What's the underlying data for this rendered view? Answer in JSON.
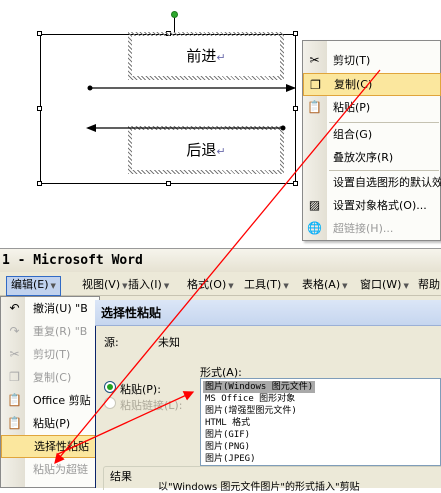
{
  "diagram": {
    "shape_forward_text": "前进",
    "shape_back_text": "后退",
    "paragraph_mark": "↵"
  },
  "context_menu": {
    "items": [
      {
        "label": "剪切(T)",
        "icon": "scissors-icon",
        "state": "normal"
      },
      {
        "label": "复制(C)",
        "icon": "copy-icon",
        "state": "highlighted"
      },
      {
        "label": "粘贴(P)",
        "icon": "paste-icon",
        "state": "normal"
      },
      {
        "label": "组合(G)",
        "icon": "",
        "state": "normal",
        "submenu": true
      },
      {
        "label": "叠放次序(R)",
        "icon": "",
        "state": "normal",
        "submenu": true
      },
      {
        "label": "设置自选图形的默认效果",
        "icon": "",
        "state": "normal"
      },
      {
        "label": "设置对象格式(O)...",
        "icon": "format-object-icon",
        "state": "normal"
      },
      {
        "label": "超链接(H)...",
        "icon": "hyperlink-icon",
        "state": "disabled"
      }
    ]
  },
  "window": {
    "title": "1 - Microsoft Word"
  },
  "menubar": {
    "items": [
      {
        "label": "编辑(E)",
        "open": true
      },
      {
        "label": "视图(V)"
      },
      {
        "label": "插入(I)"
      },
      {
        "label": "格式(O)"
      },
      {
        "label": "工具(T)"
      },
      {
        "label": "表格(A)"
      },
      {
        "label": "窗口(W)"
      },
      {
        "label": "帮助"
      }
    ]
  },
  "edit_menu": {
    "items": [
      {
        "label": "撤消(U) \"B",
        "icon": "undo-icon",
        "state": "normal"
      },
      {
        "label": "重复(R) \"B",
        "icon": "redo-icon",
        "state": "disabled"
      },
      {
        "label": "剪切(T)",
        "icon": "scissors-icon",
        "state": "disabled"
      },
      {
        "label": "复制(C)",
        "icon": "copy-icon",
        "state": "disabled"
      },
      {
        "label": "Office 剪贴",
        "icon": "clipboard-icon",
        "state": "normal"
      },
      {
        "label": "粘贴(P)",
        "icon": "paste-icon",
        "state": "normal"
      },
      {
        "label": "选择性粘贴",
        "icon": "",
        "state": "highlighted"
      },
      {
        "label": "粘贴为超链",
        "icon": "",
        "state": "disabled"
      }
    ]
  },
  "paste_special": {
    "title": "选择性粘贴",
    "source_label": "源:",
    "source_value": "未知",
    "as_label": "形式(A):",
    "paste_option": "粘贴(P):",
    "paste_link_option": "粘贴链接(L):",
    "as_options": [
      "图片(Windows 图元文件)",
      "MS Office 图形对象",
      "图片(增强型图元文件)",
      "HTML 格式",
      "图片(GIF)",
      "图片(PNG)",
      "图片(JPEG)"
    ],
    "selected_index": 0,
    "result_label": "结果",
    "result_text": "以\"Windows 图元文件图片\"的形式插入\"剪贴"
  },
  "colors": {
    "highlight_fill": "#fbe79e",
    "highlight_border": "#e0a53c",
    "annotation_arrow": "#ff0000",
    "rotation_handle": "#2ea82e"
  }
}
